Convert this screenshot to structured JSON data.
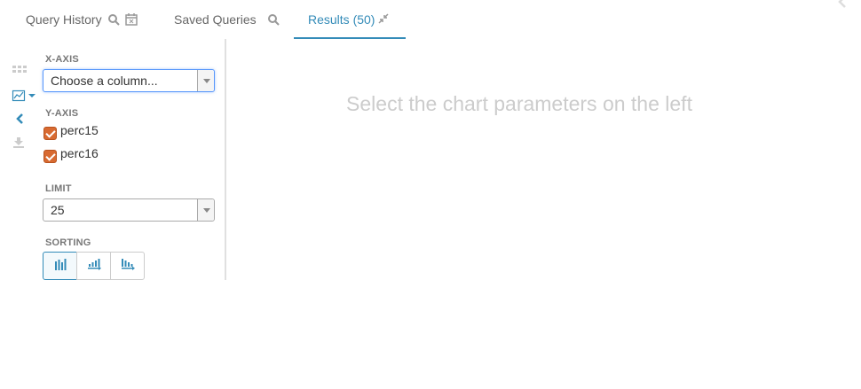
{
  "tabs": {
    "query_history": "Query History",
    "saved_queries": "Saved Queries",
    "results": "Results (50)"
  },
  "panel": {
    "x_axis": {
      "label": "X-AXIS",
      "placeholder": "Choose a column..."
    },
    "y_axis": {
      "label": "Y-AXIS",
      "columns": [
        {
          "name": "perc15",
          "checked": true
        },
        {
          "name": "perc16",
          "checked": true
        }
      ]
    },
    "limit": {
      "label": "LIMIT",
      "value": "25"
    },
    "sorting": {
      "label": "SORTING",
      "options": [
        "sort-none-icon",
        "sort-ascending-icon",
        "sort-descending-icon"
      ],
      "selected": "sort-none-icon"
    }
  },
  "message": "Select the chart parameters on the left",
  "colors": {
    "accent": "#338bb8",
    "checkbox": "#d86a31",
    "muted_text": "#cccccc"
  },
  "icons": {
    "toolbar": [
      "grid-icon",
      "chart-icon",
      "collapse-chevron-icon",
      "download-icon"
    ],
    "tabs": [
      "search-icon",
      "calendar-icon",
      "search-icon",
      "compress-icon"
    ]
  }
}
